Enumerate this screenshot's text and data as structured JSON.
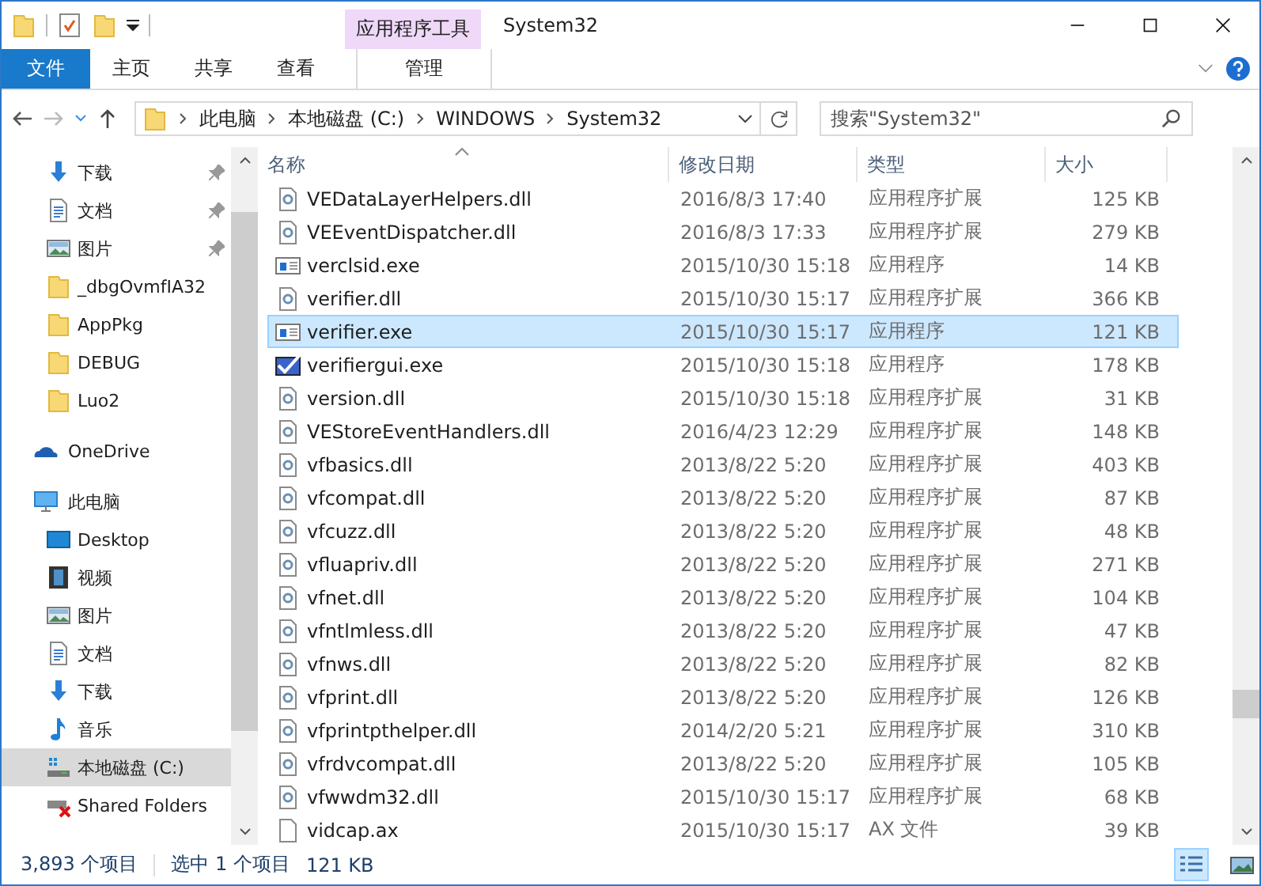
{
  "window": {
    "title": "System32",
    "context_tab_group": "应用程序工具"
  },
  "ribbon_tabs": [
    {
      "label": "文件",
      "kind": "file"
    },
    {
      "label": "主页",
      "kind": "normal"
    },
    {
      "label": "共享",
      "kind": "normal"
    },
    {
      "label": "查看",
      "kind": "normal"
    },
    {
      "label": "管理",
      "kind": "context"
    }
  ],
  "address": {
    "crumbs": [
      "此电脑",
      "本地磁盘 (C:)",
      "WINDOWS",
      "System32"
    ]
  },
  "search": {
    "placeholder": "搜索\"System32\""
  },
  "sidebar": {
    "quick_items": [
      {
        "label": "下载",
        "kind": "download",
        "pinned": true,
        "selected": false
      },
      {
        "label": "文档",
        "kind": "document",
        "pinned": true,
        "selected": false
      },
      {
        "label": "图片",
        "kind": "picture",
        "pinned": true,
        "selected": false
      },
      {
        "label": "_dbgOvmfIA32",
        "kind": "folder",
        "pinned": false,
        "selected": false
      },
      {
        "label": "AppPkg",
        "kind": "folder",
        "pinned": false,
        "selected": false
      },
      {
        "label": "DEBUG",
        "kind": "folder",
        "pinned": false,
        "selected": false
      },
      {
        "label": "Luo2",
        "kind": "folder",
        "pinned": false,
        "selected": false
      }
    ],
    "onedrive": {
      "label": "OneDrive"
    },
    "this_pc": {
      "label": "此电脑",
      "children": [
        {
          "label": "Desktop",
          "kind": "desktop",
          "selected": false
        },
        {
          "label": "视频",
          "kind": "video",
          "selected": false
        },
        {
          "label": "图片",
          "kind": "picture",
          "selected": false
        },
        {
          "label": "文档",
          "kind": "document",
          "selected": false
        },
        {
          "label": "下载",
          "kind": "download",
          "selected": false
        },
        {
          "label": "音乐",
          "kind": "music",
          "selected": false
        },
        {
          "label": "本地磁盘 (C:)",
          "kind": "drive",
          "selected": true
        },
        {
          "label": "Shared Folders",
          "kind": "shared",
          "selected": false
        }
      ]
    }
  },
  "table": {
    "columns": [
      "名称",
      "修改日期",
      "类型",
      "大小"
    ],
    "rows": [
      {
        "name": "VEDataLayerHelpers.dll",
        "date": "2016/8/3 17:40",
        "type": "应用程序扩展",
        "size": "125 KB",
        "kind": "dll",
        "selected": false
      },
      {
        "name": "VEEventDispatcher.dll",
        "date": "2016/8/3 17:33",
        "type": "应用程序扩展",
        "size": "279 KB",
        "kind": "dll",
        "selected": false
      },
      {
        "name": "verclsid.exe",
        "date": "2015/10/30 15:18",
        "type": "应用程序",
        "size": "14 KB",
        "kind": "exe",
        "selected": false
      },
      {
        "name": "verifier.dll",
        "date": "2015/10/30 15:17",
        "type": "应用程序扩展",
        "size": "366 KB",
        "kind": "dll",
        "selected": false
      },
      {
        "name": "verifier.exe",
        "date": "2015/10/30 15:17",
        "type": "应用程序",
        "size": "121 KB",
        "kind": "exe",
        "selected": true
      },
      {
        "name": "verifiergui.exe",
        "date": "2015/10/30 15:18",
        "type": "应用程序",
        "size": "178 KB",
        "kind": "gui",
        "selected": false
      },
      {
        "name": "version.dll",
        "date": "2015/10/30 15:18",
        "type": "应用程序扩展",
        "size": "31 KB",
        "kind": "dll",
        "selected": false
      },
      {
        "name": "VEStoreEventHandlers.dll",
        "date": "2016/4/23 12:29",
        "type": "应用程序扩展",
        "size": "148 KB",
        "kind": "dll",
        "selected": false
      },
      {
        "name": "vfbasics.dll",
        "date": "2013/8/22 5:20",
        "type": "应用程序扩展",
        "size": "403 KB",
        "kind": "dll",
        "selected": false
      },
      {
        "name": "vfcompat.dll",
        "date": "2013/8/22 5:20",
        "type": "应用程序扩展",
        "size": "87 KB",
        "kind": "dll",
        "selected": false
      },
      {
        "name": "vfcuzz.dll",
        "date": "2013/8/22 5:20",
        "type": "应用程序扩展",
        "size": "48 KB",
        "kind": "dll",
        "selected": false
      },
      {
        "name": "vfluapriv.dll",
        "date": "2013/8/22 5:20",
        "type": "应用程序扩展",
        "size": "271 KB",
        "kind": "dll",
        "selected": false
      },
      {
        "name": "vfnet.dll",
        "date": "2013/8/22 5:20",
        "type": "应用程序扩展",
        "size": "104 KB",
        "kind": "dll",
        "selected": false
      },
      {
        "name": "vfntlmless.dll",
        "date": "2013/8/22 5:20",
        "type": "应用程序扩展",
        "size": "47 KB",
        "kind": "dll",
        "selected": false
      },
      {
        "name": "vfnws.dll",
        "date": "2013/8/22 5:20",
        "type": "应用程序扩展",
        "size": "82 KB",
        "kind": "dll",
        "selected": false
      },
      {
        "name": "vfprint.dll",
        "date": "2013/8/22 5:20",
        "type": "应用程序扩展",
        "size": "126 KB",
        "kind": "dll",
        "selected": false
      },
      {
        "name": "vfprintpthelper.dll",
        "date": "2014/2/20 5:21",
        "type": "应用程序扩展",
        "size": "310 KB",
        "kind": "dll",
        "selected": false
      },
      {
        "name": "vfrdvcompat.dll",
        "date": "2013/8/22 5:20",
        "type": "应用程序扩展",
        "size": "105 KB",
        "kind": "dll",
        "selected": false
      },
      {
        "name": "vfwwdm32.dll",
        "date": "2015/10/30 15:17",
        "type": "应用程序扩展",
        "size": "68 KB",
        "kind": "dll",
        "selected": false
      },
      {
        "name": "vidcap.ax",
        "date": "2015/10/30 15:17",
        "type": "AX 文件",
        "size": "39 KB",
        "kind": "file",
        "selected": false
      }
    ]
  },
  "status_bar": {
    "count": "3,893 个项目",
    "selection": "选中 1 个项目",
    "size": "121 KB",
    "views": [
      {
        "kind": "details",
        "selected": true
      },
      {
        "kind": "large",
        "selected": false
      }
    ]
  }
}
